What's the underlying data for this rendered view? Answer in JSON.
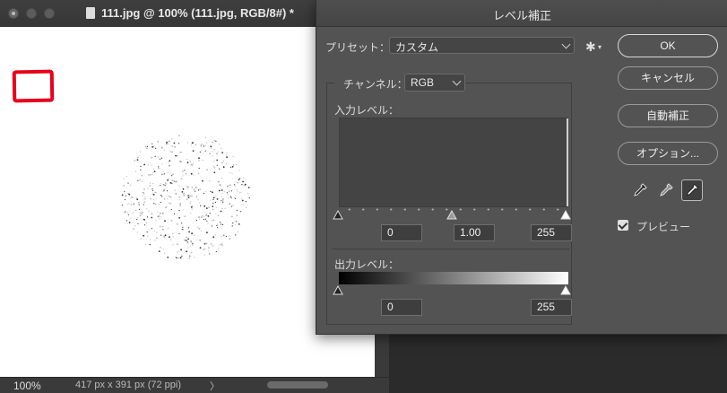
{
  "document": {
    "title": "111.jpg @ 100% (111.jpg, RGB/8#) *",
    "zoom": "100%",
    "dimensions": "417 px x 391 px (72 ppi)",
    "status_arrow": "〉"
  },
  "dialog": {
    "title": "レベル補正",
    "preset_label": "プリセット：",
    "preset_value": "カスタム",
    "channel_label": "チャンネル：",
    "channel_value": "RGB",
    "input_levels_label": "入力レベル：",
    "input_black": "0",
    "input_gamma": "1.00",
    "input_white": "255",
    "output_levels_label": "出力レベル：",
    "output_black": "0",
    "output_white": "255",
    "buttons": {
      "ok": "OK",
      "cancel": "キャンセル",
      "auto": "自動補正",
      "options": "オプション..."
    },
    "preview_label": "プレビュー",
    "preview_checked": true
  },
  "colors": {
    "annotation_red": "#e8001c",
    "dialog_bg": "#535353"
  }
}
